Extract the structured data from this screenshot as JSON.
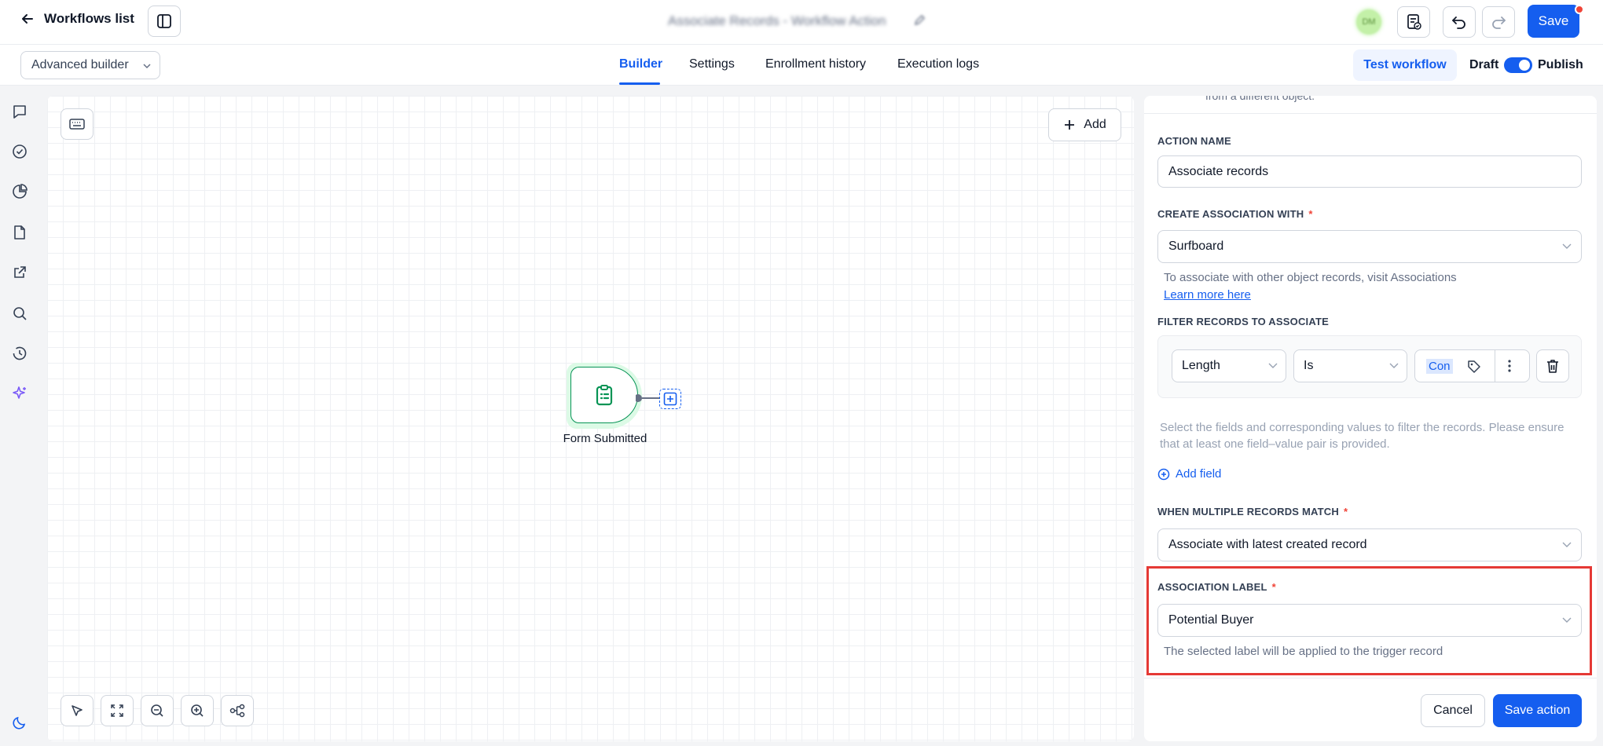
{
  "header": {
    "back_label": "Workflows list",
    "workflow_title": "Associate Records - Workflow Action",
    "avatar_initials": "DM",
    "save_label": "Save"
  },
  "subnav": {
    "mode_select": "Advanced builder",
    "tabs": [
      {
        "label": "Builder",
        "active": true
      },
      {
        "label": "Settings",
        "active": false
      },
      {
        "label": "Enrollment history",
        "active": false
      },
      {
        "label": "Execution logs",
        "active": false
      }
    ],
    "test_label": "Test workflow",
    "draft_label": "Draft",
    "publish_label": "Publish",
    "publish_on": true
  },
  "canvas": {
    "add_label": "Add",
    "node_label": "Form Submitted"
  },
  "panel": {
    "cut_text": "from a different object.",
    "action_name_label": "ACTION NAME",
    "action_name_value": "Associate records",
    "assoc_with_label": "CREATE ASSOCIATION WITH",
    "assoc_with_value": "Surfboard",
    "assoc_hint": "To associate with other object records, visit Associations",
    "learn_more": "Learn more here",
    "filter_label": "FILTER RECORDS TO ASSOCIATE",
    "filter_field": "Length",
    "filter_operator": "Is",
    "filter_value": "Con",
    "filter_hint": "Select the fields and corresponding values to filter the records. Please ensure that at least one field–value pair is provided.",
    "add_field": "Add field",
    "multi_match_label": "WHEN MULTIPLE RECORDS MATCH",
    "multi_match_value": "Associate with latest created record",
    "assoc_label_label": "ASSOCIATION LABEL",
    "assoc_label_value": "Potential Buyer",
    "assoc_label_hint": "The selected label will be applied to the trigger record",
    "cancel_label": "Cancel",
    "save_action_label": "Save action"
  },
  "colors": {
    "accent": "#155eef",
    "trigger_green": "#079455",
    "highlight_red": "#e53935",
    "required": "#f04438"
  }
}
